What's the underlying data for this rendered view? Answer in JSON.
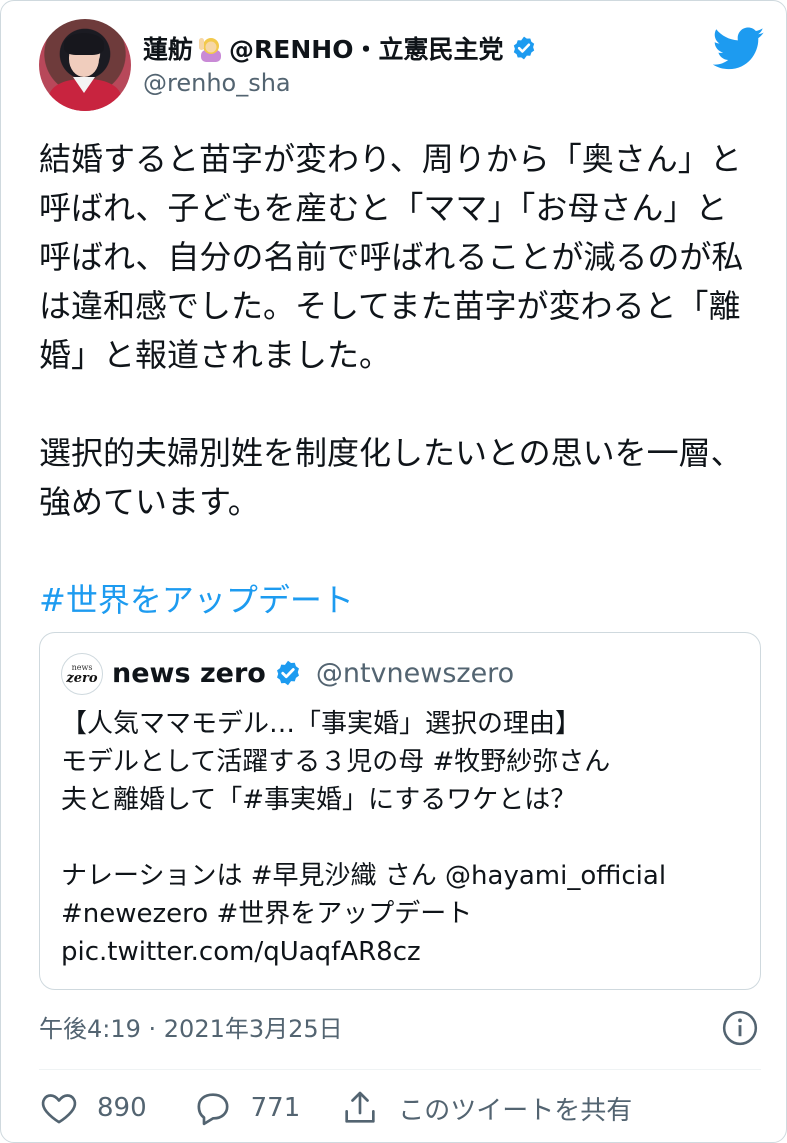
{
  "author": {
    "display_name": "蓮舫",
    "name_suffix": "@RENHO・立憲民主党",
    "handle": "@renho_sha"
  },
  "tweet": {
    "paragraphs": [
      "結婚すると苗字が変わり、周りから「奥さん」と呼ばれ、子どもを産むと「ママ」「お母さん」と呼ばれ、自分の名前で呼ばれることが減るのが私は違和感でした。そしてまた苗字が変わると「離婚」と報道されました。",
      "選択的夫婦別姓を制度化したいとの思いを一層、強めています。"
    ],
    "hashtag": "#世界をアップデート"
  },
  "quote": {
    "avatar_line1": "news",
    "avatar_line2": "zero",
    "name": "news zero",
    "handle": "@ntvnewszero",
    "lines": [
      "【人気ママモデル…「事実婚」選択の理由】",
      "モデルとして活躍する３児の母 #牧野紗弥さん",
      "夫と離婚して「#事実婚」にするワケとは？",
      "",
      "ナレーションは #早見沙織 さん @hayami_official",
      "#newezero #世界をアップデート",
      "pic.twitter.com/qUaqfAR8cz"
    ]
  },
  "meta": {
    "timestamp": "午後4:19 · 2021年3月25日"
  },
  "actions": {
    "likes": "890",
    "replies": "771",
    "share_label": "このツイートを共有"
  },
  "colors": {
    "accent": "#1d9bf0",
    "text": "#0f1419",
    "muted": "#536471",
    "border": "#cfd9de"
  }
}
